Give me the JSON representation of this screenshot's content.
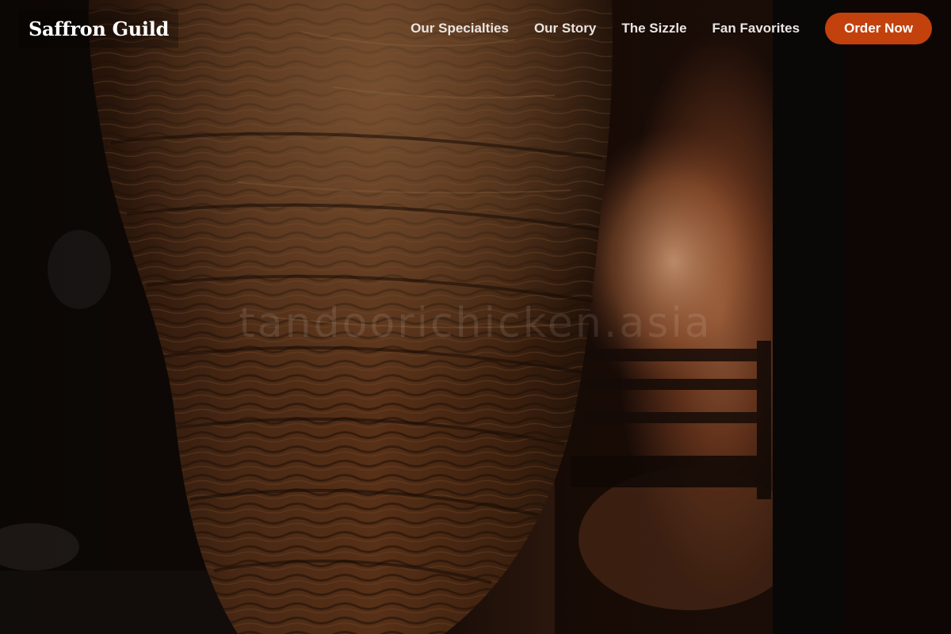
{
  "brand": {
    "name": "Saffron Guild"
  },
  "nav": {
    "items": [
      {
        "label": "Our Specialties"
      },
      {
        "label": "Our Story"
      },
      {
        "label": "The Sizzle"
      },
      {
        "label": "Fan Favorites"
      }
    ],
    "cta_label": "Order Now"
  },
  "hero": {
    "image_description": "hero-photo-grilled-meat-spit",
    "watermark": "tandoorichicken.asia"
  },
  "colors": {
    "accent": "#c2410c",
    "nav_text": "#e9e5e1",
    "background": "#0b0705"
  }
}
